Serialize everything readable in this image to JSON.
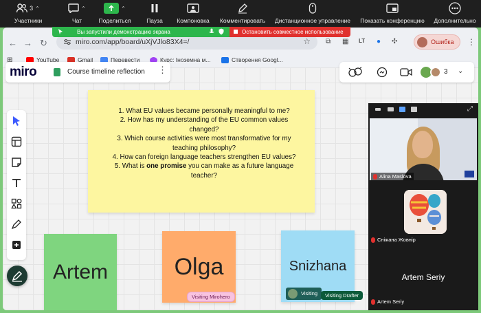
{
  "zoom_toolbar": {
    "participants": {
      "label": "Участники",
      "count": "3"
    },
    "chat": {
      "label": "Чат"
    },
    "share": {
      "label": "Поделиться"
    },
    "pause": {
      "label": "Пауза"
    },
    "layout": {
      "label": "Компоновка"
    },
    "comment": {
      "label": "Комментировать"
    },
    "remote": {
      "label": "Дистанционное управление"
    },
    "show_conf": {
      "label": "Показать конференцию"
    },
    "more": {
      "label": "Дополнительно"
    }
  },
  "share_banner": {
    "text": "Вы запустили демонстрацию экрана",
    "stop_label": "Остановить совместное использование",
    "color": "#2db64c",
    "stop_color": "#e0312e"
  },
  "browser": {
    "url": "miro.com/app/board/uXjVJlo83X4=/",
    "profile_label": "Ошибка",
    "bookmarks": [
      {
        "label": "YouTube",
        "color": "#ff0000"
      },
      {
        "label": "Gmail",
        "color": "#d93025"
      },
      {
        "label": "Перевести",
        "color": "#4285f4"
      },
      {
        "label": "Курс: Іноземна м...",
        "color": "#a142f4"
      },
      {
        "label": "Створення Googl...",
        "color": "#1a73e8"
      }
    ]
  },
  "miro": {
    "logo": "miro",
    "board_name": "Course timeline reflection",
    "collaborator_count": "3",
    "questions": [
      {
        "text": "1. What EU values became personally meaningful to me?"
      },
      {
        "text": "2. How has my understanding of the EU common values changed?"
      },
      {
        "text": "3. Which course activities were most transformative for my teaching philosophy?"
      },
      {
        "text": "4. How can foreign language teachers strengthen EU values?"
      },
      {
        "pre": "5. What is ",
        "bold": "one promise",
        "post": " you can make as a future language teacher?"
      }
    ],
    "notes": {
      "artem": "Artem",
      "olga": "Olga",
      "snizhana": "Snizhana"
    },
    "cursor_tags": {
      "mirohero": "Visiting Mirohero",
      "visiting": "Visiting",
      "drafter": "Visiting Drafter"
    }
  },
  "video_panel": {
    "participants": [
      {
        "name": "Alina Maslova"
      },
      {
        "name": "Сніжана Жовнір"
      },
      {
        "name": "Artem Seriy"
      }
    ],
    "big_name": "Artem Seriy"
  }
}
